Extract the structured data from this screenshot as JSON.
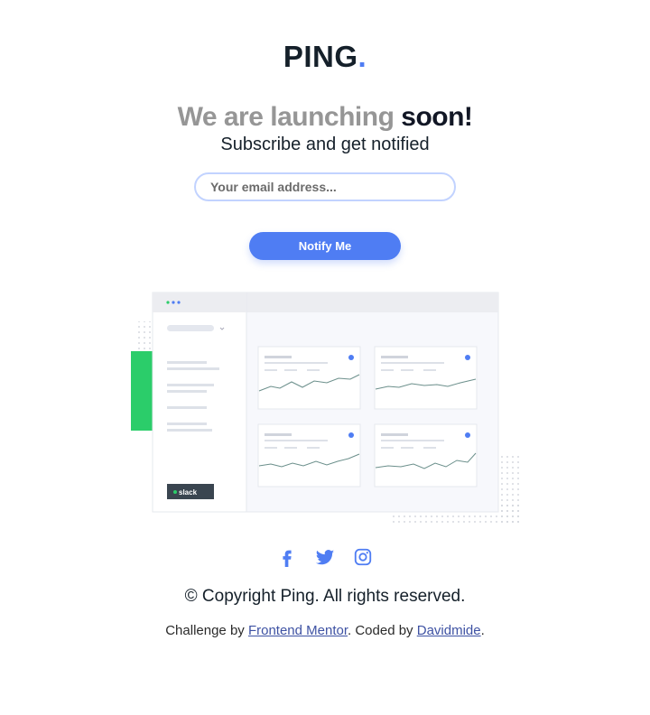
{
  "logo": {
    "text": "PING",
    "dot": "."
  },
  "headline": {
    "muted": "We are launching",
    "strong": "soon!"
  },
  "subline": "Subscribe and get notified",
  "form": {
    "email_placeholder": "Your email address...",
    "button_label": "Notify Me"
  },
  "illustration": {
    "sidebar_badge": "slack"
  },
  "social": [
    {
      "name": "facebook-icon"
    },
    {
      "name": "twitter-icon"
    },
    {
      "name": "instagram-icon"
    }
  ],
  "footer": {
    "copyright": "© Copyright Ping. All rights reserved.",
    "credits_prefix": "Challenge by",
    "credits_link1": "Frontend Mentor",
    "credits_middle": ". Coded by",
    "credits_link2": "Davidmide",
    "credits_suffix": "."
  },
  "colors": {
    "accent": "#4F7DF3",
    "dark": "#15202A",
    "muted": "#969696",
    "input_border": "#C2D3FF",
    "green": "#2BCD6A"
  }
}
